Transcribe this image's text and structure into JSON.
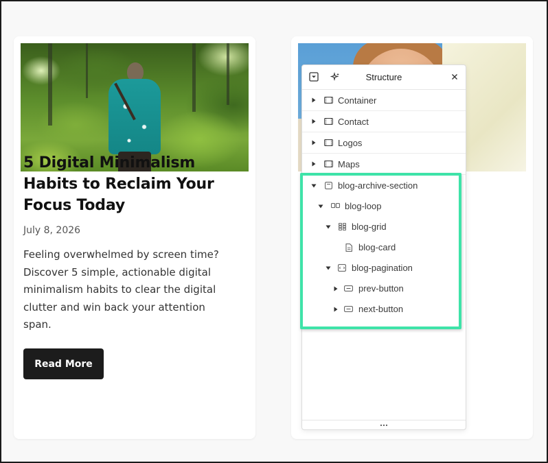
{
  "post": {
    "title": "5 Digital Minimalism Habits to Reclaim Your Focus Today",
    "date": "July 8, 2026",
    "excerpt": "Feeling overwhelmed by screen time? Discover 5 simple, actionable digital minimalism habits to clear the digital clutter and win back your attention span.",
    "read_more_label": "Read More"
  },
  "structure_panel": {
    "title": "Structure",
    "top_items": [
      {
        "label": "Container",
        "icon": "container-icon"
      },
      {
        "label": "Contact",
        "icon": "container-icon"
      },
      {
        "label": "Logos",
        "icon": "container-icon"
      },
      {
        "label": "Maps",
        "icon": "container-icon"
      }
    ],
    "tree": [
      {
        "label": "blog-archive-section",
        "icon": "section-icon",
        "expanded": true,
        "depth": 0
      },
      {
        "label": "blog-loop",
        "icon": "loop-icon",
        "expanded": true,
        "depth": 1
      },
      {
        "label": "blog-grid",
        "icon": "grid-icon",
        "expanded": true,
        "depth": 2
      },
      {
        "label": "blog-card",
        "icon": "card-icon",
        "expanded": null,
        "depth": 3
      },
      {
        "label": "blog-pagination",
        "icon": "pagination-icon",
        "expanded": true,
        "depth": 2
      },
      {
        "label": "prev-button",
        "icon": "button-icon",
        "expanded": false,
        "depth": 3
      },
      {
        "label": "next-button",
        "icon": "button-icon",
        "expanded": false,
        "depth": 3
      }
    ],
    "footer_handle": "..."
  },
  "colors": {
    "highlight": "#3ee3a8",
    "button_bg": "#1c1c1c"
  }
}
